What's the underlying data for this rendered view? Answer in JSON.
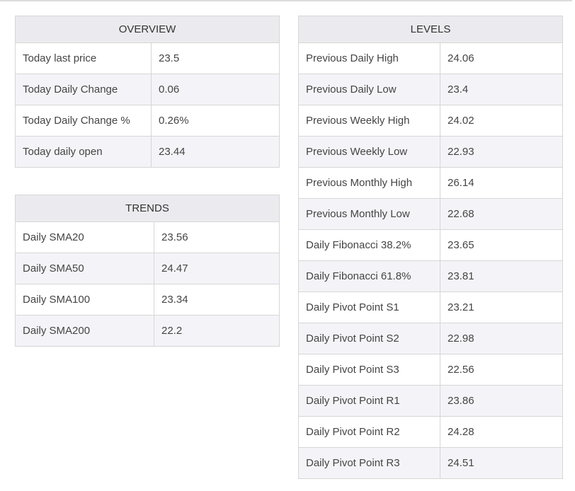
{
  "overview": {
    "title": "OVERVIEW",
    "rows": [
      {
        "label": "Today last price",
        "value": "23.5"
      },
      {
        "label": "Today Daily Change",
        "value": "0.06"
      },
      {
        "label": "Today Daily Change %",
        "value": "0.26%"
      },
      {
        "label": "Today daily open",
        "value": "23.44"
      }
    ]
  },
  "trends": {
    "title": "TRENDS",
    "rows": [
      {
        "label": "Daily SMA20",
        "value": "23.56"
      },
      {
        "label": "Daily SMA50",
        "value": "24.47"
      },
      {
        "label": "Daily SMA100",
        "value": "23.34"
      },
      {
        "label": "Daily SMA200",
        "value": "22.2"
      }
    ]
  },
  "levels": {
    "title": "LEVELS",
    "rows": [
      {
        "label": "Previous Daily High",
        "value": "24.06"
      },
      {
        "label": "Previous Daily Low",
        "value": "23.4"
      },
      {
        "label": "Previous Weekly High",
        "value": "24.02"
      },
      {
        "label": "Previous Weekly Low",
        "value": "22.93"
      },
      {
        "label": "Previous Monthly High",
        "value": "26.14"
      },
      {
        "label": "Previous Monthly Low",
        "value": "22.68"
      },
      {
        "label": "Daily Fibonacci 38.2%",
        "value": "23.65"
      },
      {
        "label": "Daily Fibonacci 61.8%",
        "value": "23.81"
      },
      {
        "label": "Daily Pivot Point S1",
        "value": "23.21"
      },
      {
        "label": "Daily Pivot Point S2",
        "value": "22.98"
      },
      {
        "label": "Daily Pivot Point S3",
        "value": "22.56"
      },
      {
        "label": "Daily Pivot Point R1",
        "value": "23.86"
      },
      {
        "label": "Daily Pivot Point R2",
        "value": "24.28"
      },
      {
        "label": "Daily Pivot Point R3",
        "value": "24.51"
      }
    ]
  },
  "colors": {
    "header_bg": "#ebebef",
    "row_alt_bg": "#f4f4f8",
    "border": "#d6d6d6",
    "text": "#444444"
  }
}
